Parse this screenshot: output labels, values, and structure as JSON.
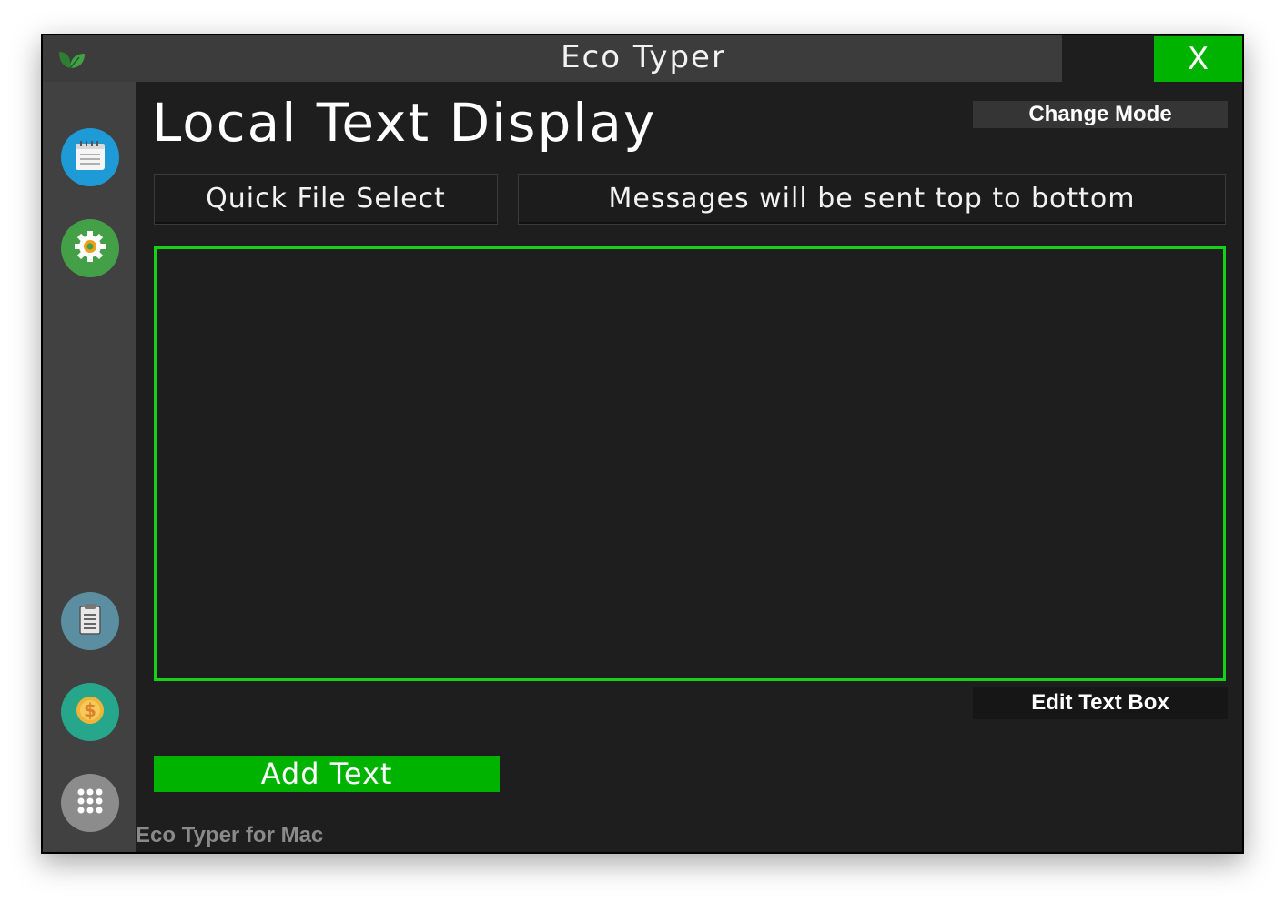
{
  "window": {
    "title": "Eco Typer",
    "minimize_label": "_",
    "close_label": "X",
    "accent_color": "#00b300"
  },
  "sidebar": {
    "items": [
      {
        "name": "notepad",
        "icon": "notepad-icon",
        "color": "#1e9ad6"
      },
      {
        "name": "settings",
        "icon": "gear-icon",
        "color": "#43a047"
      },
      {
        "name": "clipboard",
        "icon": "clipboard-icon",
        "color": "#5b8ea0"
      },
      {
        "name": "donate",
        "icon": "dollar-coin-icon",
        "color": "#26a68a"
      },
      {
        "name": "apps",
        "icon": "app-grid-icon",
        "color": "#8c8c8c"
      }
    ]
  },
  "main": {
    "page_title": "Local Text Display",
    "change_mode_label": "Change Mode",
    "quick_file_select_label": "Quick File Select",
    "messages_info": "Messages will be sent top to bottom",
    "text_box_value": "",
    "edit_text_box_label": "Edit Text Box",
    "add_text_label": "Add Text"
  },
  "footer": {
    "text": "Eco Typer for Mac"
  }
}
